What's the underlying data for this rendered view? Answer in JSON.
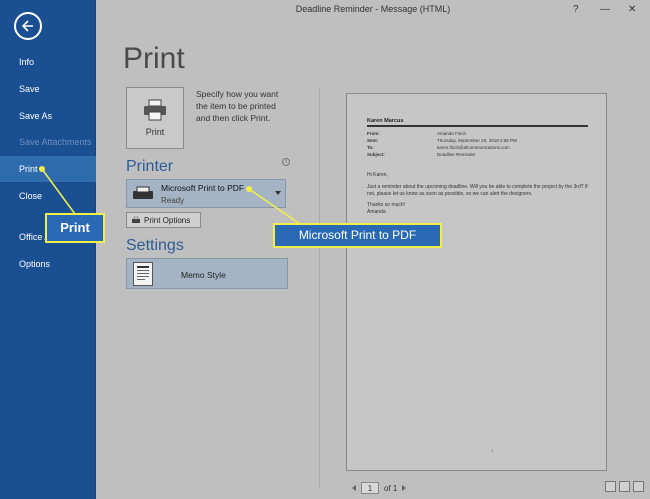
{
  "window": {
    "title": "Deadline Reminder - Message (HTML)",
    "help_symbol": "?",
    "minimize_symbol": "—",
    "close_symbol": "✕"
  },
  "sidebar": {
    "items": [
      {
        "label": "Info"
      },
      {
        "label": "Save"
      },
      {
        "label": "Save As"
      },
      {
        "label": "Save Attachments"
      },
      {
        "label": "Print"
      },
      {
        "label": "Close"
      },
      {
        "label": "Office Account"
      },
      {
        "label": "Options"
      }
    ]
  },
  "print_page": {
    "heading": "Print",
    "print_button_label": "Print",
    "description": "Specify how you want the item to be printed and then click Print.",
    "printer_heading": "Printer",
    "printer_name": "Microsoft Print to PDF",
    "printer_status": "Ready",
    "print_options_label": "Print Options",
    "settings_heading": "Settings",
    "settings_style": "Memo Style"
  },
  "preview": {
    "sender_name": "Karen Marcus",
    "rows": [
      {
        "key": "From:",
        "value": "Amanda Finch"
      },
      {
        "key": "Sent:",
        "value": "Thursday, September 20, 2018 2:58 PM"
      },
      {
        "key": "To:",
        "value": "karen.finch@afcommunications.com"
      },
      {
        "key": "Subject:",
        "value": "Deadline Reminder"
      }
    ],
    "greeting": "Hi Karen,",
    "body": "Just a reminder about the upcoming deadline. Will you be able to complete the project by the 3rd? If not, please let us know as soon as possible, so we can alert the designers.",
    "closing": "Thanks so much!",
    "signature": "Amanda",
    "footer": "1",
    "pager_current": "1",
    "pager_total": "of 1"
  },
  "callouts": {
    "print": "Print",
    "printer": "Microsoft Print to PDF"
  },
  "colors": {
    "sidebar": "#1a4f91",
    "accent": "#2c5d99",
    "highlight": "#f2ef4a"
  }
}
